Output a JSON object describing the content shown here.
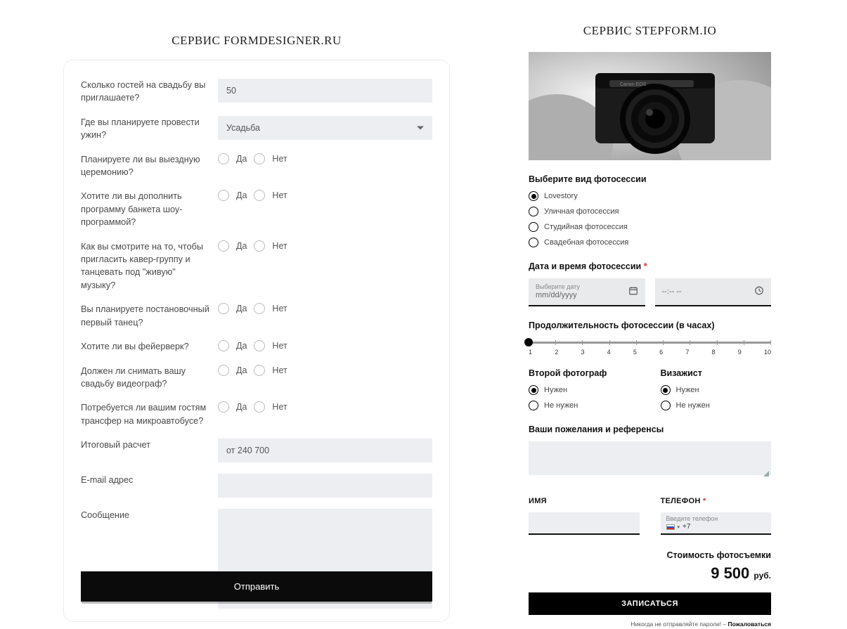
{
  "left": {
    "heading": "СЕРВИС FORMDESIGNER.RU",
    "guests_label": "Сколько гостей на свадьбу вы приглашаете?",
    "guests_value": "50",
    "dinner_label": "Где вы планируете провести ужин?",
    "dinner_value": "Усадьба",
    "yes": "Да",
    "no": "Нет",
    "q_ceremony": "Планируете ли вы выездную церемонию?",
    "q_show": "Хотите ли вы дополнить программу банкета шоу-программой?",
    "q_cover": "Как вы смотрите на то, чтобы пригласить кавер-группу и танцевать под \"живую\" музыку?",
    "q_dance": "Вы планируете постановочный первый танец?",
    "q_fireworks": "Хотите ли вы фейерверк?",
    "q_video": "Должен ли снимать вашу свадьбу видеограф?",
    "q_transfer": "Потребуется ли вашим гостям трансфер на микроавтобусе?",
    "total_label": "Итоговый расчет",
    "total_value": "от 240 700",
    "email_label": "E-mail адрес",
    "message_label": "Сообщение",
    "submit": "Отправить"
  },
  "right": {
    "heading": "СЕРВИС STEPFORM.IO",
    "type_label": "Выберите вид фотосессии",
    "type_options": [
      "Lovestory",
      "Уличная фотосессия",
      "Студийная фотосессия",
      "Свадебная фотосессия"
    ],
    "datetime_label": "Дата и время фотосессии",
    "date_placeholder": "Выберите дату",
    "date_value": "mm/dd/yyyy",
    "time_value": "--:-- --",
    "duration_label": "Продолжительность фотосессии (в часах)",
    "second_label": "Второй фотограф",
    "makeup_label": "Визажист",
    "need": "Нужен",
    "not_need": "Не нужен",
    "wishes_label": "Ваши пожелания и референсы",
    "name_label": "ИМЯ",
    "phone_label": "ТЕЛЕФОН",
    "phone_placeholder": "Введите телефон",
    "phone_prefix": "+7",
    "price_title": "Стоимость фотосъемки",
    "price_value": "9 500",
    "price_currency": "руб.",
    "signup": "ЗАПИСАТЬСЯ",
    "fineprint_a": "Никогда не отправляйте пароли! –",
    "fineprint_b": "Пожаловаться"
  },
  "slider_ticks": [
    "1",
    "2",
    "3",
    "4",
    "5",
    "6",
    "7",
    "8",
    "9",
    "10"
  ]
}
